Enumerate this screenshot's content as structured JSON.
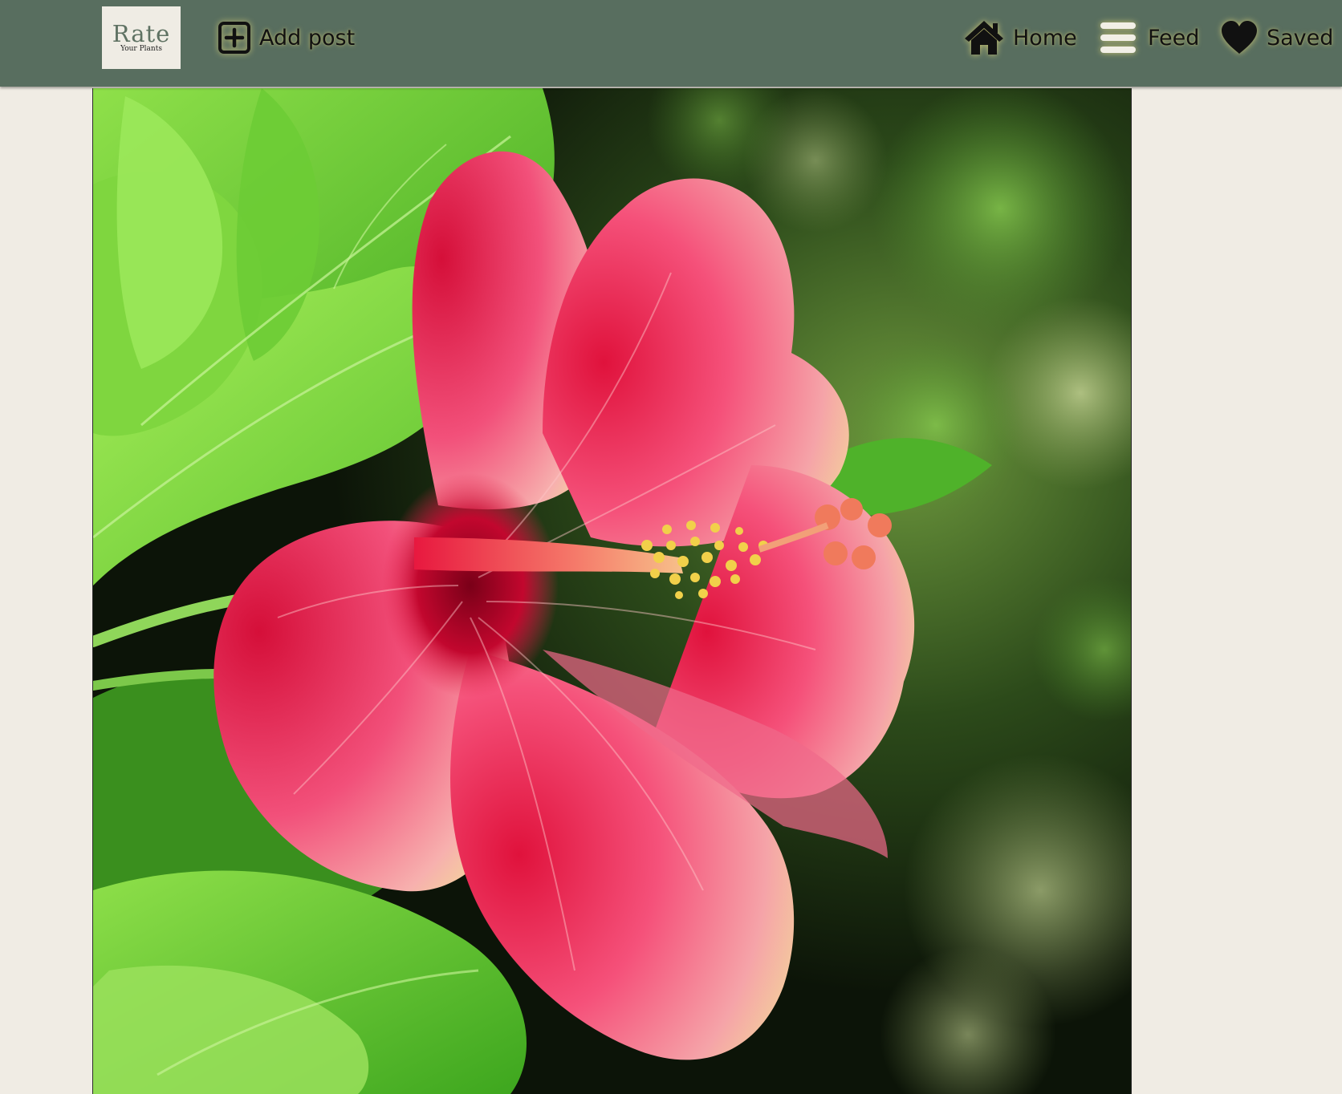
{
  "header": {
    "logo": {
      "title": "Rate",
      "subtitle": "Your Plants"
    },
    "add_post_label": "Add post",
    "nav": {
      "home_label": "Home",
      "feed_label": "Feed",
      "saved_label": "Saved"
    },
    "icons": {
      "add": "plus-square-icon",
      "home": "home-icon",
      "feed": "menu-icon",
      "saved": "heart-icon"
    }
  },
  "colors": {
    "header_bg": "#586e5f",
    "page_bg": "#f0ece4",
    "logo_bg": "#efece4",
    "icon_glow": "#f0e178"
  }
}
